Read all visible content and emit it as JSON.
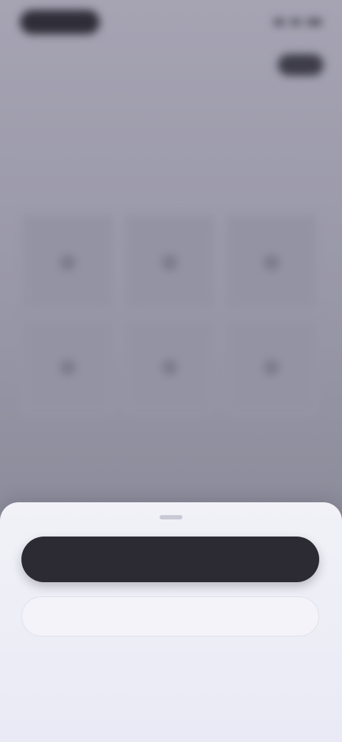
{
  "status_bar": {
    "time": "",
    "icons": [
      "signal-icon",
      "wifi-icon",
      "battery-icon"
    ]
  },
  "header": {
    "title": "",
    "action_label": ""
  },
  "content": {
    "heading": "",
    "description": "",
    "tiles": [
      {
        "icon": "tile-icon"
      },
      {
        "icon": "tile-icon"
      },
      {
        "icon": "tile-icon"
      },
      {
        "icon": "tile-icon"
      },
      {
        "icon": "tile-icon"
      },
      {
        "icon": "tile-icon"
      }
    ]
  },
  "sheet": {
    "primary_label": "",
    "secondary_label": "",
    "tertiary_label": ""
  },
  "colors": {
    "primary_button": "#2c2b33",
    "sheet_background": "#eaeaf6",
    "backdrop": "#9a99a8"
  }
}
